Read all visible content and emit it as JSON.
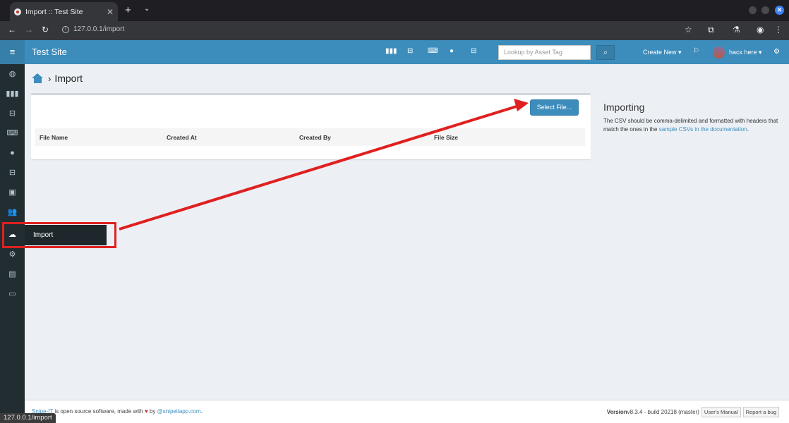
{
  "browser": {
    "tab_title": "Import :: Test Site",
    "url": "127.0.0.1/import",
    "status_url": "127.0.0.1/import"
  },
  "app": {
    "brand": "Test Site",
    "lookup_placeholder": "Lookup by Asset Tag",
    "create_new": "Create New ▾",
    "user": "hacx here ▾"
  },
  "sidebar": {
    "flyout_label": "Import"
  },
  "page": {
    "title": "Import",
    "select_button": "Select File...",
    "columns": [
      "File Name",
      "Created At",
      "Created By",
      "File Size"
    ]
  },
  "info": {
    "heading": "Importing",
    "text_before": "The CSV should be comma-delimited and formatted with headers that match the ones in the ",
    "link": "sample CSVs in the documentation",
    "text_after": "."
  },
  "footer": {
    "brand_link": "Snipe-IT",
    "text": " is open source software, made with ",
    "heart": "♥",
    "by": " by ",
    "author_link": "@snipeitapp.com",
    "period": ".",
    "version_label": "Version",
    "version_value": " v8.3.4 - build 20218 (master)",
    "manual": "User's Manual",
    "report": "Report a bug"
  },
  "colors": {
    "primary": "#3c8dbc",
    "sidebar": "#222d32",
    "annotation": "#e02020"
  }
}
